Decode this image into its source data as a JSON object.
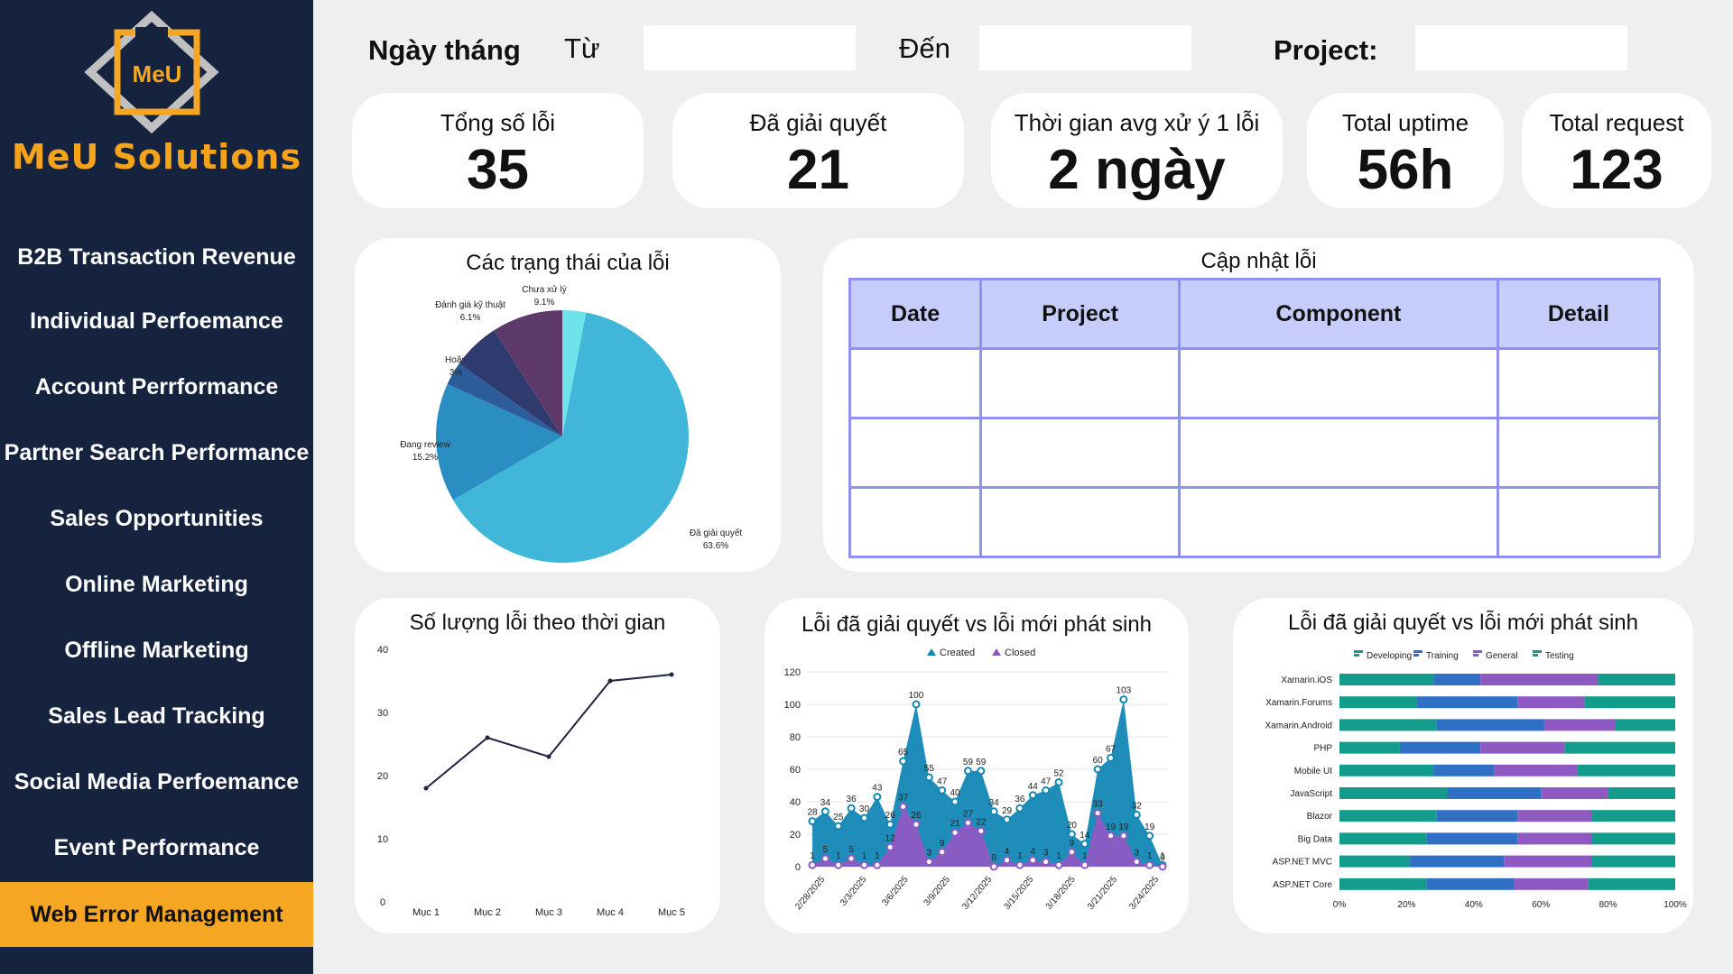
{
  "brand": {
    "logo_text": "MeU",
    "name": "MeU Solutions"
  },
  "nav": [
    {
      "label": "B2B Transaction Revenue",
      "active": false
    },
    {
      "label": "Individual Perfoemance",
      "active": false
    },
    {
      "label": "Account Perrformance",
      "active": false
    },
    {
      "label": "Partner Search Performance",
      "active": false
    },
    {
      "label": "Sales Opportunities",
      "active": false
    },
    {
      "label": "Online Marketing",
      "active": false
    },
    {
      "label": "Offline Marketing",
      "active": false
    },
    {
      "label": "Sales Lead Tracking",
      "active": false
    },
    {
      "label": "Social Media Perfoemance",
      "active": false
    },
    {
      "label": "Event Performance",
      "active": false
    },
    {
      "label": "Web Error Management",
      "active": true
    }
  ],
  "filters": {
    "date_label": "Ngày tháng",
    "from_label": "Từ",
    "to_label": "Đến",
    "project_label": "Project:",
    "from_value": "",
    "to_value": "",
    "project_value": ""
  },
  "kpis": [
    {
      "label": "Tổng số lỗi",
      "value": "35"
    },
    {
      "label": "Đã giải quyết",
      "value": "21"
    },
    {
      "label": "Thời gian avg xử ý 1 lỗi",
      "value": "2 ngày"
    },
    {
      "label": "Total uptime",
      "value": "56h"
    },
    {
      "label": "Total request",
      "value": "123"
    }
  ],
  "update_table": {
    "title": "Cập nhật lỗi",
    "columns": [
      "Date",
      "Project",
      "Component",
      "Detail"
    ],
    "rows": [
      [
        "",
        "",
        "",
        ""
      ],
      [
        "",
        "",
        "",
        ""
      ],
      [
        "",
        "",
        "",
        ""
      ]
    ]
  },
  "colors": {
    "sidebar": "#16233f",
    "accent": "#f5a623",
    "table_header": "#c7cdfb",
    "table_border": "#8f92f0"
  },
  "chart_data": [
    {
      "type": "pie",
      "title": "Các trạng thái của lỗi",
      "slices": [
        {
          "label": "Đã giải quyết",
          "value": 63.6,
          "display": "63.6%",
          "color": "#40b6d9"
        },
        {
          "label": "Đang review",
          "value": 15.2,
          "display": "15.2%",
          "color": "#2b8ec2"
        },
        {
          "label": "Hoãn",
          "value": 3,
          "display": "3%",
          "color": "#2d5c9a"
        },
        {
          "label": "Đánh giá kỹ thuật",
          "value": 6.1,
          "display": "6.1%",
          "color": "#2f3a6e"
        },
        {
          "label": "Chưa xử lý",
          "value": 9.1,
          "display": "9.1%",
          "color": "#5d3a6a"
        },
        {
          "label": "",
          "value": 3,
          "display": "",
          "color": "#6fe3ea"
        }
      ]
    },
    {
      "type": "line",
      "title": "Số lượng lỗi theo thời gian",
      "categories": [
        "Mục 1",
        "Mục 2",
        "Mục 3",
        "Mục 4",
        "Mục 5"
      ],
      "values": [
        18,
        26,
        23,
        35,
        36
      ],
      "ylim": [
        0,
        40
      ],
      "yticks": [
        0,
        10,
        20,
        30,
        40
      ]
    },
    {
      "type": "area",
      "title": "Lỗi đã giải quyết vs lỗi mới phát sinh",
      "x_labels": [
        "2/28/2025",
        "3/3/2025",
        "3/6/2025",
        "3/9/2025",
        "3/12/2025",
        "3/15/2025",
        "3/18/2025",
        "3/21/2025",
        "3/24/2025"
      ],
      "ylim": [
        0,
        120
      ],
      "yticks": [
        0,
        20,
        40,
        60,
        80,
        100,
        120
      ],
      "series": [
        {
          "name": "Created",
          "color": "#1287b5",
          "values": [
            28,
            34,
            25,
            36,
            30,
            43,
            26,
            65,
            100,
            55,
            47,
            40,
            59,
            59,
            34,
            29,
            36,
            44,
            47,
            52,
            20,
            14,
            60,
            67,
            103,
            32,
            19,
            1
          ]
        },
        {
          "name": "Closed",
          "color": "#8e5ac2",
          "values": [
            1,
            5,
            1,
            5,
            1,
            1,
            12,
            37,
            26,
            3,
            9,
            21,
            27,
            22,
            0,
            4,
            1,
            4,
            3,
            1,
            9,
            1,
            33,
            19,
            19,
            3,
            1,
            0
          ]
        }
      ]
    },
    {
      "type": "bar",
      "title": "Lỗi đã giải quyết vs lỗi mới phát sinh",
      "stacked_percent": true,
      "categories": [
        "Xamarin.iOS",
        "Xamarin.Forums",
        "Xamarin.Android",
        "PHP",
        "Mobile UI",
        "JavaScript",
        "Blazor",
        "Big Data",
        "ASP.NET MVC",
        "ASP.NET Core"
      ],
      "xticks": [
        "0%",
        "20%",
        "40%",
        "60%",
        "80%",
        "100%"
      ],
      "series": [
        {
          "name": "Developing",
          "color": "#139b8b",
          "values": [
            28,
            23,
            29,
            18,
            28,
            32,
            29,
            26,
            21,
            26
          ]
        },
        {
          "name": "Training",
          "color": "#2f6fc4",
          "values": [
            14,
            30,
            32,
            24,
            18,
            28,
            24,
            27,
            28,
            26
          ]
        },
        {
          "name": "General",
          "color": "#8e5ac2",
          "values": [
            35,
            20,
            21,
            25,
            25,
            20,
            22,
            22,
            26,
            22
          ]
        },
        {
          "name": "Testing",
          "color": "#139b8b",
          "values": [
            23,
            27,
            18,
            33,
            29,
            20,
            25,
            25,
            25,
            26
          ]
        }
      ]
    }
  ]
}
